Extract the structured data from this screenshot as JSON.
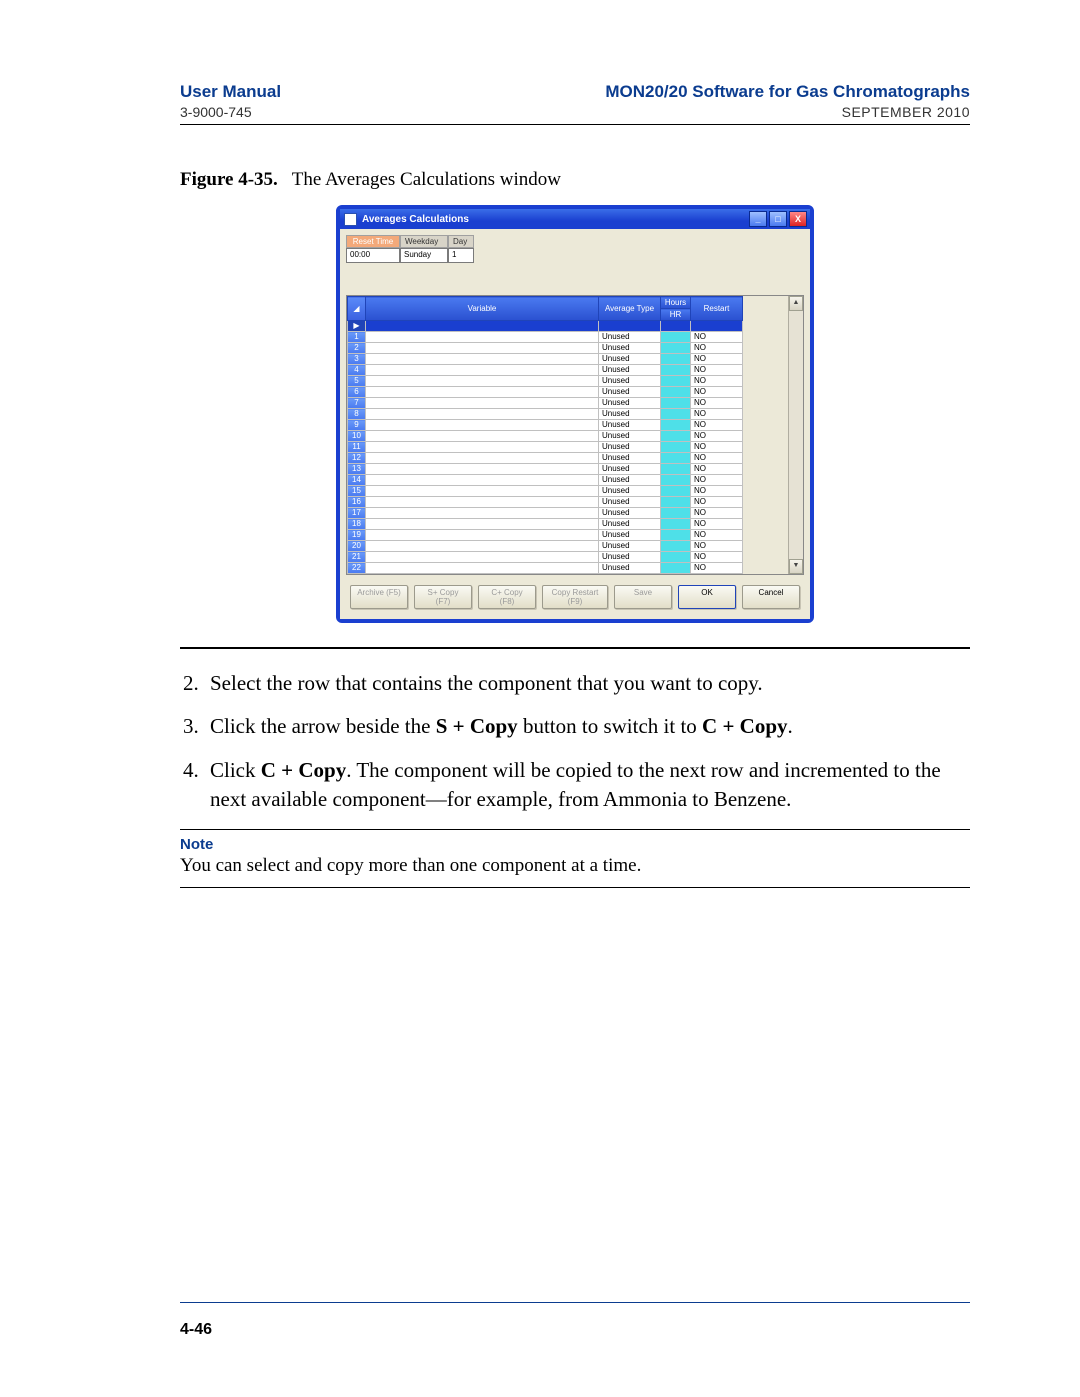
{
  "header": {
    "left_top": "User Manual",
    "left_sub": "3-9000-745",
    "right_top": "MON20/20 Software for Gas Chromatographs",
    "right_sub": "SEPTEMBER 2010"
  },
  "figure": {
    "label": "Figure 4-35.",
    "caption": "The Averages Calculations window"
  },
  "window": {
    "title": "Averages Calculations",
    "fields": {
      "reset_time": {
        "label": "Reset Time",
        "value": "00:00"
      },
      "weekday": {
        "label": "Weekday",
        "value": "Sunday"
      },
      "day": {
        "label": "Day",
        "value": "1"
      }
    },
    "columns": {
      "variable": "Variable",
      "avg_type": "Average Type",
      "hours": "Hours",
      "hours_sub": "HR",
      "restart": "Restart"
    },
    "row_default": {
      "avg_type": "Unused",
      "restart": "NO"
    },
    "row_count": 22,
    "buttons": {
      "archive": "Archive (F5)",
      "scopy": "S+ Copy (F7)",
      "ccopy": "C+ Copy (F8)",
      "copyrestart": "Copy Restart (F9)",
      "save": "Save",
      "ok": "OK",
      "cancel": "Cancel"
    }
  },
  "steps": {
    "s2": "Select the row that contains the component that you want to copy.",
    "s3a": "Click the arrow beside the ",
    "s3b": "S + Copy",
    "s3c": " button to switch it to ",
    "s3d": "C + Copy",
    "s3e": ".",
    "s4a": "Click ",
    "s4b": "C + Copy",
    "s4c": ". The component will be copied to the next row and incremented to the next available component—for example, from Ammonia to Benzene."
  },
  "note": {
    "label": "Note",
    "body": "You can select and copy more than one component at a time."
  },
  "footer": {
    "page": "4-46"
  }
}
